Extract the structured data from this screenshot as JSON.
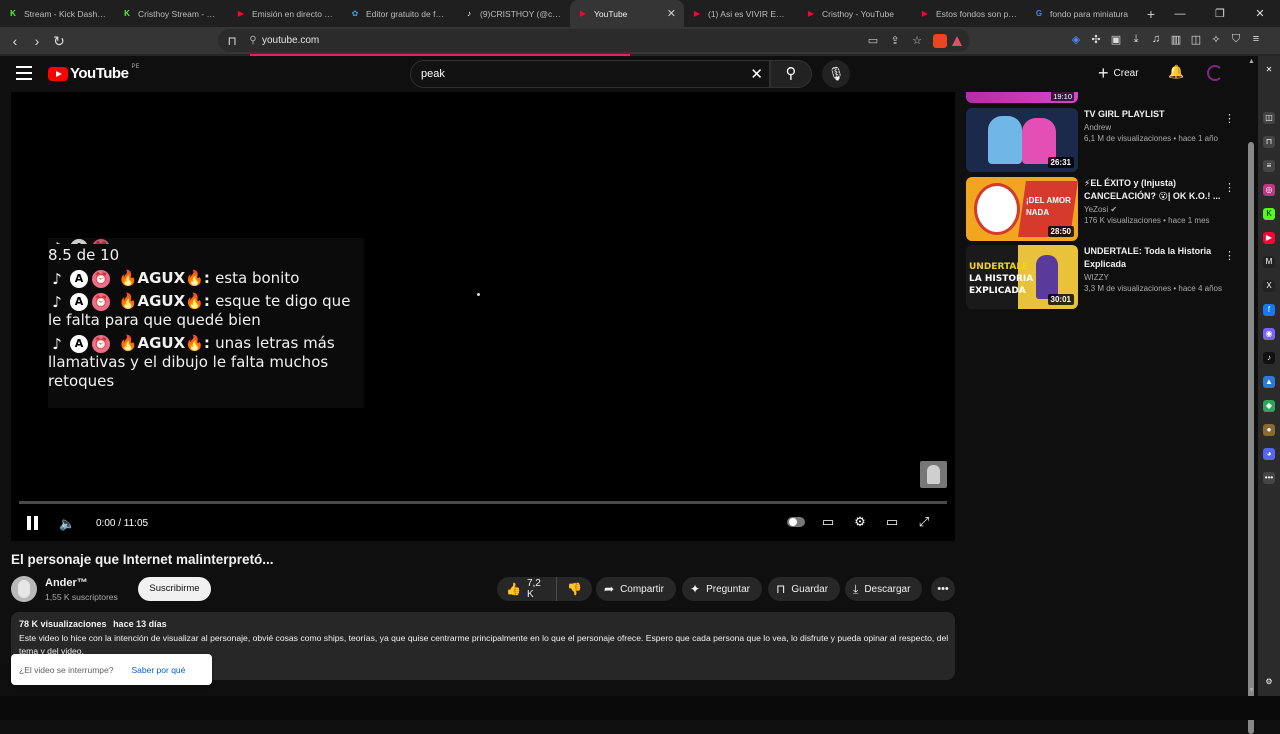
{
  "browser": {
    "tabs": [
      {
        "label": "Stream - Kick Dashboa",
        "fav_color": "#53fc18",
        "fav_glyph": "K"
      },
      {
        "label": "Cristhoy Stream - Wat",
        "fav_color": "#53fc18",
        "fav_glyph": "K"
      },
      {
        "label": "Emisión en directo - Yo",
        "fav_color": "#ff0033",
        "fav_glyph": "▶"
      },
      {
        "label": "Editor gratuito de fotos",
        "fav_color": "#3aa0d8",
        "fav_glyph": "✿"
      },
      {
        "label": "(9)CRISTHOY (@cristho",
        "fav_color": "#111111",
        "fav_glyph": "♪"
      },
      {
        "label": "YouTube",
        "fav_color": "#ff0033",
        "fav_glyph": "▶",
        "active": true
      },
      {
        "label": "(1) Asi es VIVIR EN VEN",
        "fav_color": "#ff0033",
        "fav_glyph": "▶"
      },
      {
        "label": "Cristhoy - YouTube",
        "fav_color": "#ff0033",
        "fav_glyph": "▶"
      },
      {
        "label": "Estos fondos son para",
        "fav_color": "#ff0033",
        "fav_glyph": "▶"
      },
      {
        "label": "fondo para miniatura",
        "fav_color": "#4285f4",
        "fav_glyph": "G"
      }
    ],
    "url": "youtube.com"
  },
  "masthead": {
    "logo_text": "YouTube",
    "country_code": "PE",
    "search_query": "peak",
    "create_label": "Crear"
  },
  "player": {
    "chat": {
      "partial_line": "8.5 de 10",
      "messages": [
        {
          "user": "AGUX",
          "text": "esta bonito"
        },
        {
          "user": "AGUX",
          "text": "esque te digo que le falta para que quedé bien"
        },
        {
          "user": "AGUX",
          "text": "unas letras más llamativas y el dibujo le falta muchos retoques"
        }
      ]
    },
    "time": "0:00 / 11:05"
  },
  "video": {
    "title": "El personaje que Internet malinterpretó...",
    "channel": "Ander™",
    "subscribers": "1,55 K suscriptores",
    "subscribe_label": "Suscribirme",
    "likes": "7,2 K",
    "share_label": "Compartir",
    "ask_label": "Preguntar",
    "save_label": "Guardar",
    "download_label": "Descargar",
    "views": "78 K visualizaciones",
    "age": "hace 13 días",
    "description": "Este video lo hice con la intención de visualizar al personaje, obvié cosas como ships, teorías, ya que quise centrarme principalmente en lo que el personaje ofrece. Espero que cada persona que lo vea, lo disfrute y pueda opinar al respecto, del tema y del video."
  },
  "toast": {
    "question": "¿El video se interrumpe?",
    "link": "Saber por qué"
  },
  "recommendations": {
    "top_partial_duration": "19:10",
    "items": [
      {
        "title": "TV GIRL PLAYLIST",
        "channel": "Andrew",
        "stats": "6,1 M de visualizaciones • hace 1 año",
        "duration": "26:31"
      },
      {
        "title": "⚡EL ÉXITO y (Injusta) CANCELACIÓN? 😮| OK K.O.! ...",
        "channel": "YeZosi",
        "stats": "176 K visualizaciones • hace 1 mes",
        "duration": "28:50",
        "thumb_text": "¡DEL AMOR NADA"
      },
      {
        "title": "UNDERTALE: Toda la Historia Explicada",
        "channel": "WIZZY",
        "stats": "3,3 M de visualizaciones • hace 4 años",
        "duration": "30:01",
        "thumb_line1": "UNDERTALE",
        "thumb_line2": "LA HISTORIA",
        "thumb_line3": "EXPLICADA"
      }
    ]
  },
  "colors": {
    "accent": "#ff0000",
    "progress": "#e91e63",
    "link": "#065fd4"
  }
}
